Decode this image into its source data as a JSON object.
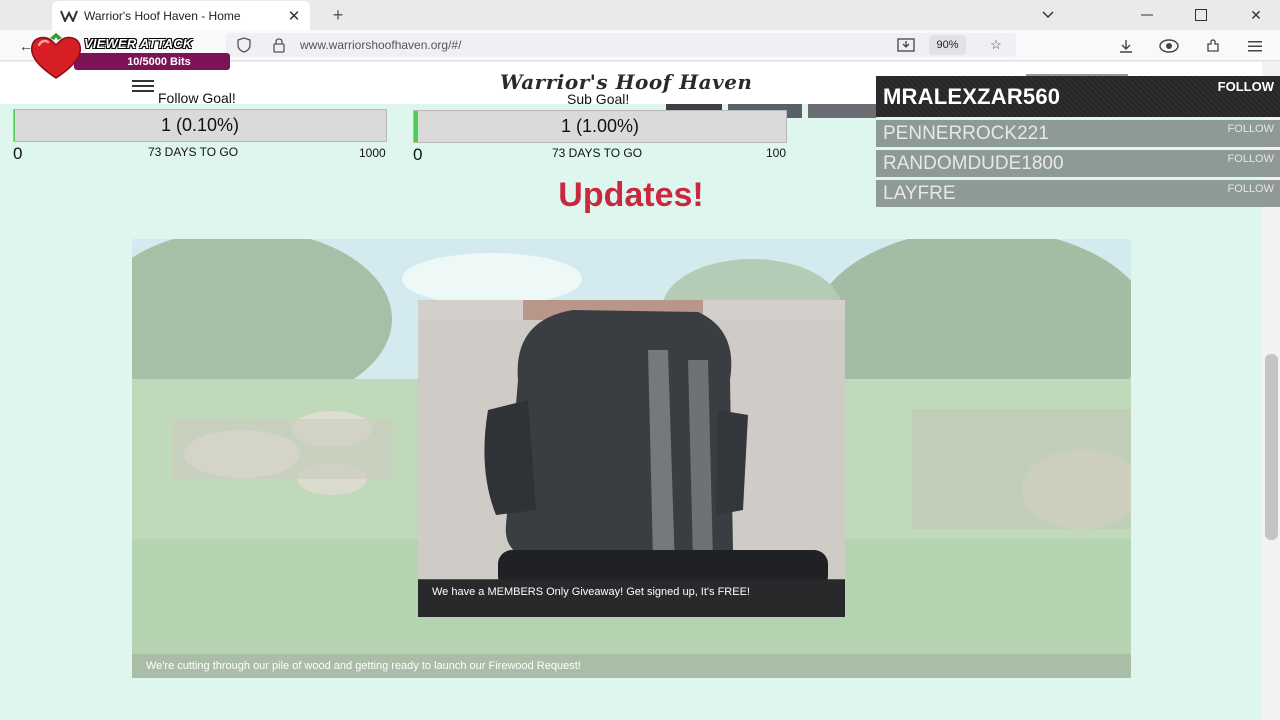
{
  "browser": {
    "tab_title": "Warrior's Hoof Haven - Home",
    "url": "www.warriorshoofhaven.org/#/",
    "zoom": "90%"
  },
  "overlay": {
    "viewer_attack_label": "VIEWER ATTACK",
    "bits_progress": "10/5000 Bits"
  },
  "site": {
    "title": "Warrior's Hoof Haven"
  },
  "goals": [
    {
      "title": "Follow Goal!",
      "value": "1 (0.10%)",
      "min": "0",
      "days": "73 DAYS TO GO",
      "max": "1000",
      "fill": 0.001
    },
    {
      "title": "Sub Goal!",
      "value": "1 (1.00%)",
      "min": "0",
      "days": "73 DAYS TO GO",
      "max": "100",
      "fill": 0.01
    }
  ],
  "updates": {
    "heading": "Updates!",
    "promo_caption": "We have a MEMBERS Only Giveaway! Get signed up, It's FREE!",
    "hero_caption": "We're cutting through our pile of wood and getting ready to launch our Firewood Request!"
  },
  "followers": {
    "latest": {
      "name": "MRALEXZAR560",
      "action": "FOLLOW"
    },
    "recent": [
      {
        "name": "PENNERROCK221",
        "action": "FOLLOW"
      },
      {
        "name": "RANDOMDUDE1800",
        "action": "FOLLOW"
      },
      {
        "name": "LAYFRE",
        "action": "FOLLOW"
      }
    ]
  },
  "colors": {
    "page_bg": "#dff6ee",
    "heading_red": "#c9293f",
    "goal_fill": "#4ccf4c",
    "bits_bar": "#7b1457"
  }
}
